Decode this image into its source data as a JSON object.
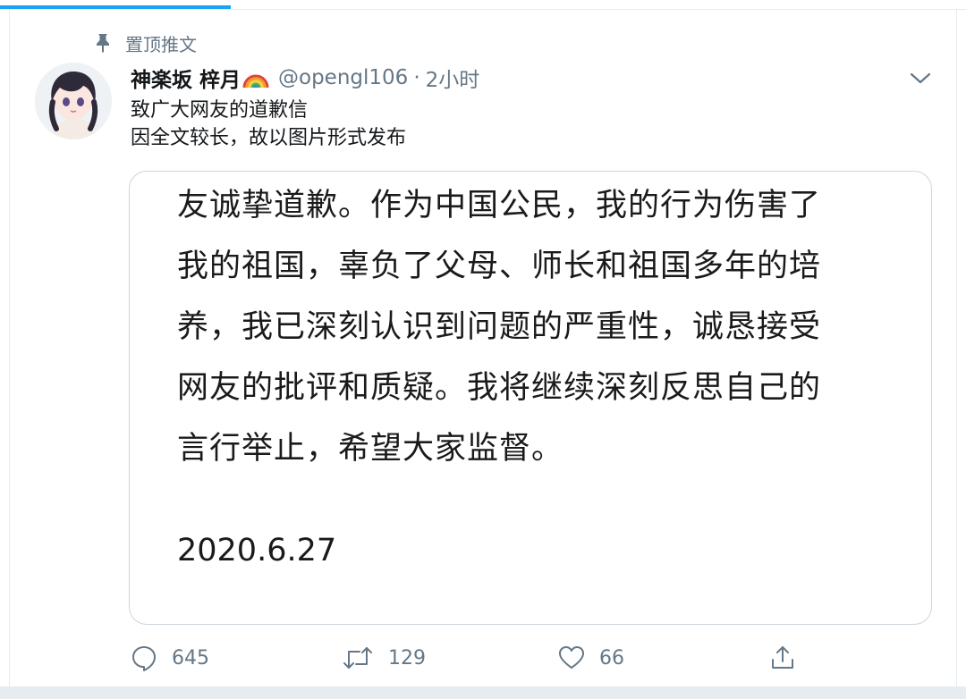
{
  "pinned": {
    "label": "置顶推文",
    "icon": "pin-icon"
  },
  "tweet": {
    "display_name": "神楽坂 梓月",
    "name_emoji": "rainbow-icon",
    "handle": "@opengl106",
    "separator": "·",
    "time": "2小时",
    "text_lines": [
      "致广大网友的道歉信",
      "因全文较长，故以图片形式发布"
    ],
    "image_text_lines": [
      "友诚挚道歉。作为中国公民，我的行为伤害了",
      "我的祖国，辜负了父母、师长和祖国多年的培",
      "养，我已深刻认识到问题的严重性，诚恳接受",
      "网友的批评和质疑。我将继续深刻反思自己的",
      "言行举止，希望大家监督。"
    ],
    "image_date": "2020.6.27"
  },
  "actions": {
    "reply_count": "645",
    "retweet_count": "129",
    "like_count": "66"
  },
  "colors": {
    "accent": "#1da1f2",
    "muted": "#657786",
    "border": "#e6ecf0"
  }
}
